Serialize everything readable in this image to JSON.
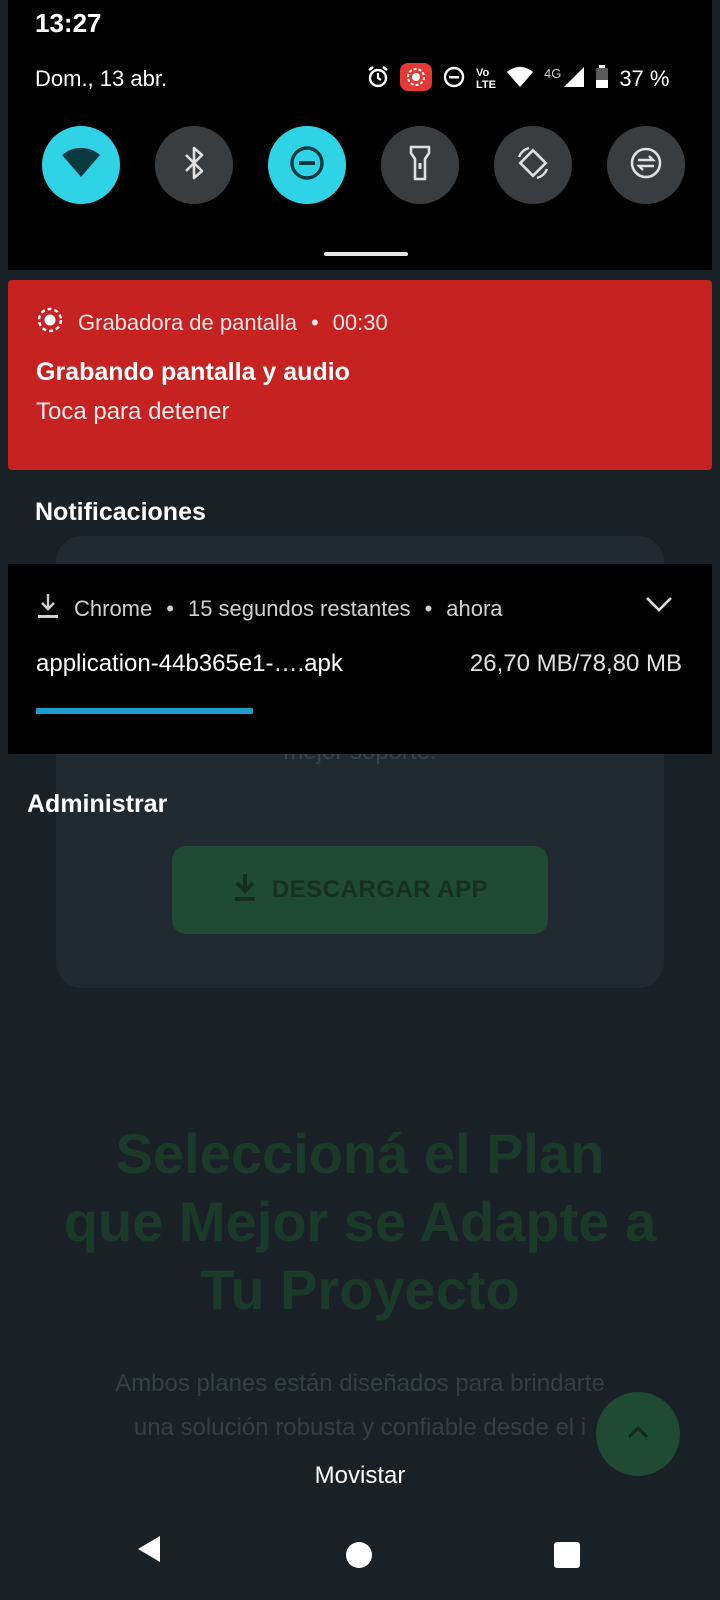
{
  "status_bar": {
    "time": "13:27"
  },
  "quick_settings": {
    "date": "Dom., 13 abr.",
    "battery_text": "37 %",
    "network_type": "4G",
    "volte_top": "Vo",
    "volte_bottom": "LTE",
    "tiles": [
      {
        "icon": "wifi-icon",
        "active": true
      },
      {
        "icon": "bluetooth-icon",
        "active": false
      },
      {
        "icon": "do-not-disturb-icon",
        "active": true
      },
      {
        "icon": "flashlight-icon",
        "active": false
      },
      {
        "icon": "auto-rotate-icon",
        "active": false
      },
      {
        "icon": "data-saver-icon",
        "active": false
      }
    ],
    "colors": {
      "tile_active": "#2ed4e6",
      "tile_inactive": "#3a3d40"
    }
  },
  "recorder_notification": {
    "app": "Grabadora de pantalla",
    "separator": "•",
    "elapsed": "00:30",
    "title": "Grabando pantalla y audio",
    "subtitle": "Toca para detener",
    "color": "#c62222"
  },
  "notifications_title": "Notificaciones",
  "download_notification": {
    "app": "Chrome",
    "separator": "•",
    "remaining": "15 segundos restantes",
    "when": "ahora",
    "filename": "application-44b365e1-….apk",
    "size": "26,70 MB/78,80 MB",
    "progress": 0.339,
    "progress_color": "#1b9ec9"
  },
  "manage_label": "Administrar",
  "background_page": {
    "partial_text": "mejor soporte.",
    "download_button": "DESCARGAR APP",
    "headline_lines": [
      "Seleccioná el Plan",
      "que Mejor se Adapte a",
      "Tu Proyecto"
    ],
    "paragraph_lines": [
      "Ambos planes están diseñados para brindarte",
      "una solución robusta y confiable desde el i"
    ]
  },
  "carrier": "Movistar"
}
